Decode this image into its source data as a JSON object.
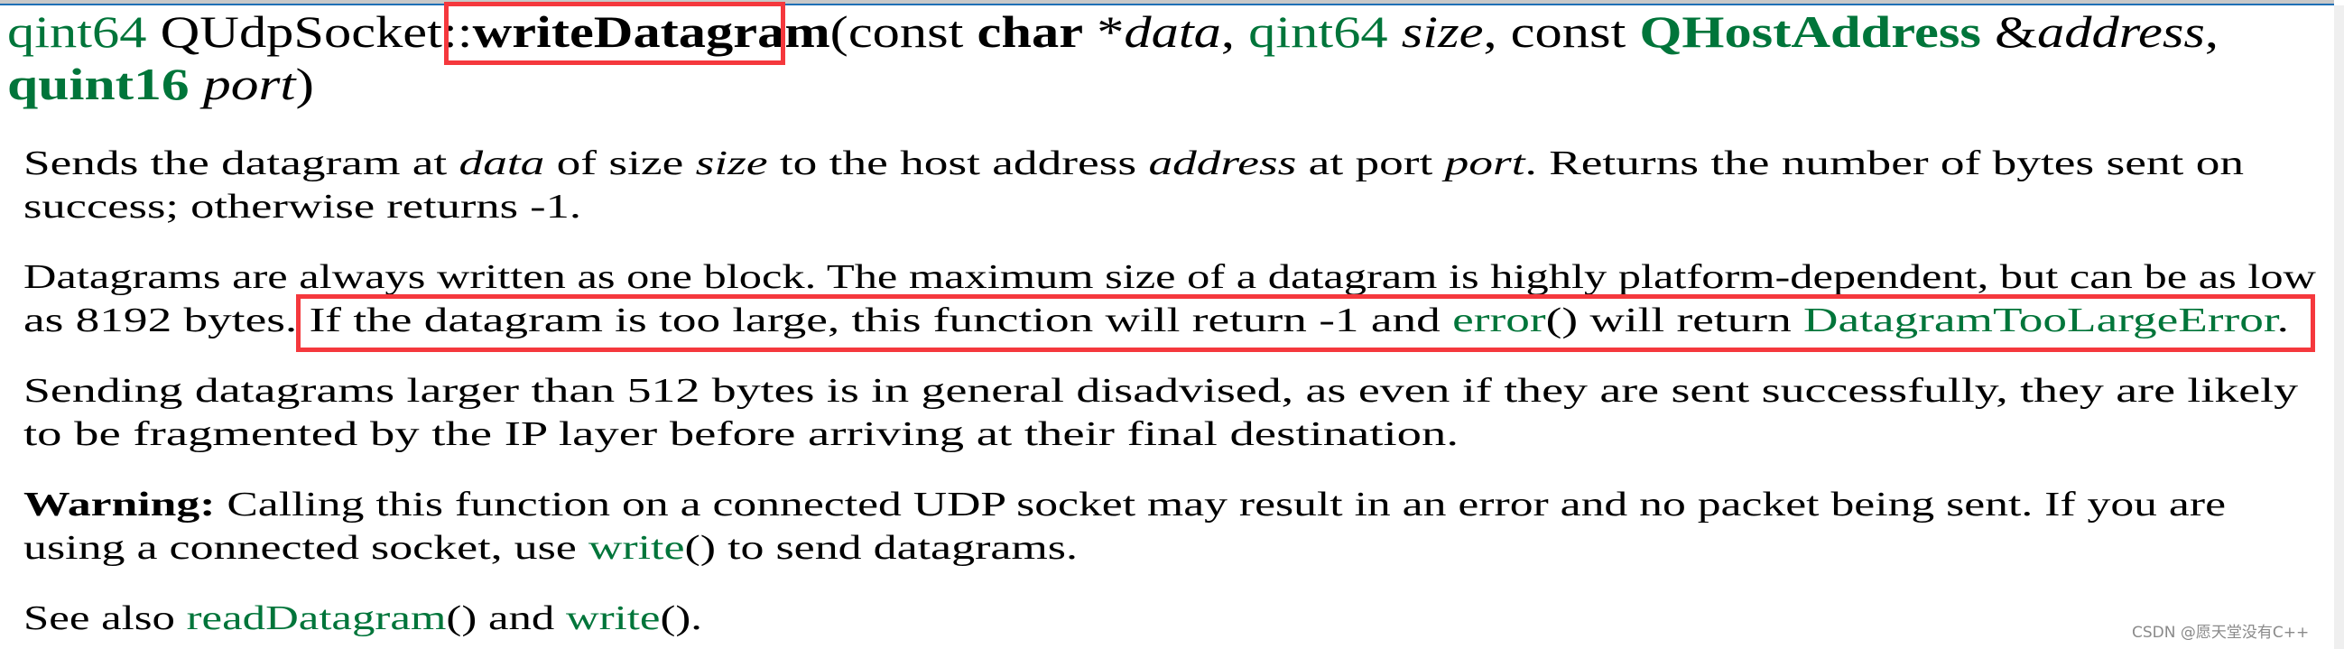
{
  "signature": {
    "return_type": "qint64",
    "class_scope": "QUdpSocket::",
    "function_name": "writeDatagram",
    "open_paren": "(",
    "param1_const": "const ",
    "param1_type": "char",
    "param1_ptr": " *",
    "param1_name": "data",
    "sep1": ", ",
    "param2_type": "qint64",
    "param2_name": "size",
    "sep2": ", ",
    "param3_const": "const ",
    "param3_type": "QHostAddress",
    "param3_ref": " &",
    "param3_name": "address",
    "sep3": ",",
    "param4_type": "quint16",
    "param4_name": "port",
    "close_paren": ")"
  },
  "paragraphs": {
    "p1": {
      "l1_a": "Sends the datagram at ",
      "l1_data": "data",
      "l1_b": " of size ",
      "l1_size": "size",
      "l1_c": " to the host address ",
      "l1_address": "address",
      "l1_d": " at port ",
      "l1_port": "port",
      "l1_e": ". Returns the number of bytes sent on",
      "l2": "success; otherwise returns -1."
    },
    "p2": {
      "l1": "Datagrams are always written as one block. The maximum size of a datagram is highly platform-dependent, but can be as low",
      "l2_a": "as 8192 bytes. ",
      "l2_b": "If the datagram is too large, this function will return -1 and ",
      "l2_link_error": "error",
      "l2_c": "() will return ",
      "l2_link_enum": "DatagramTooLargeError",
      "l2_d": "."
    },
    "p3": {
      "l1": "Sending datagrams larger than 512 bytes is in general disadvised, as even if they are sent successfully, they are likely",
      "l2": "to be fragmented by the IP layer before arriving at their final destination."
    },
    "p4": {
      "warning_label": "Warning:",
      "l1": " Calling this function on a connected UDP socket may result in an error and no packet being sent. If you are",
      "l2_a": "using a connected socket, use ",
      "l2_link_write": "write",
      "l2_b": "() to send datagrams."
    },
    "see_also": {
      "label": "See also ",
      "link_read": "readDatagram",
      "paren1": "()",
      "and": " and ",
      "link_write": "write",
      "end": "()."
    }
  },
  "watermark": "CSDN @愿天堂没有C++",
  "colors": {
    "link_green": "#00753a",
    "highlight_red": "#f5383d"
  }
}
